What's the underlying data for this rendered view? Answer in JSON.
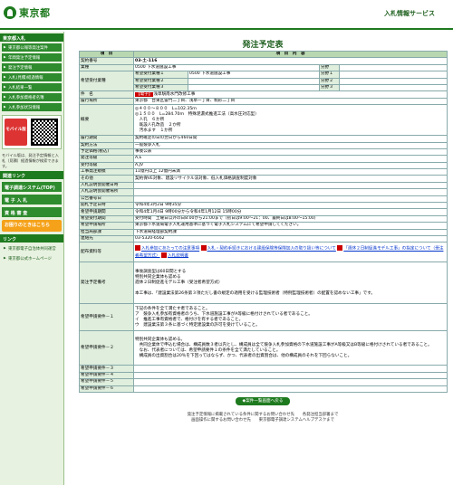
{
  "header": {
    "logo": "東京都",
    "top_link": "入札情報サービス"
  },
  "sidebar": {
    "head1": "東京都入札",
    "items1": [
      "東京都公報等発注案件",
      "年間発注予定情報",
      "発注予定情報",
      "入札(見積)経過情報",
      "入札結果一覧",
      "入札参加資格者名簿",
      "入札参加状況情報"
    ],
    "mobile_label": "モバイル版",
    "note": "モバイル版は、発注予定情報と入札（見積）経過情報が検索できます。",
    "head2": "関連リンク",
    "sys_btn": "電子調達システム(TOP)",
    "btn_bid": "電 子 入 札",
    "btn_qual": "資 格 審 査",
    "help": "お困りのときはこちら",
    "head3": "リンク",
    "items3": [
      "東京都電子自治体共同運営",
      "東京都公式ホームページ"
    ]
  },
  "main": {
    "title": "発注予定表",
    "col_item": "項　目",
    "col_content": "項　目　内　容",
    "contract_no_label": "契約番号",
    "contract_no": "03-土-116",
    "category_label": "業種",
    "category": "0500 下水道施設工事",
    "req_label": "希望受付業種",
    "req1_label": "希望受付業種１",
    "req1": "0500 下水道施設工事",
    "req2_label": "希望受付業種２",
    "req3_label": "希望受付業種３",
    "bun_label": "分野",
    "bun1": "分野１",
    "bun2": "分野２",
    "bun3": "分野３",
    "name_label": "件　名",
    "name_badge": "【電子】",
    "name": "浅草駅南水門改修工事",
    "place_label": "履行場所",
    "place": "東京都　台東区雷門二丁目、浅草一丁目、駒形二丁目",
    "summary_label": "概要",
    "summary_lines": [
      "◎４００～８００　L=102.35ｍ",
      "◎１５００　L=284.70ｍ　特殊泥濃式推進工法（高水圧対応型）",
      "　人孔　６か所",
      "　既設人孔改造　２か所",
      "　汚水ます　１か所"
    ],
    "period_label": "履行期間",
    "period": "契約確定の日の翌日から460日間",
    "method_label": "契約方法",
    "method": "一般競争入札",
    "budget_label": "予定価格(税込)",
    "budget": "事後公表",
    "rank_label": "発注等級",
    "rank": "A,E",
    "accept_label": "受付等級",
    "accept": "A,JV",
    "scale_label": "工事発注規模",
    "scale": "11億円以上 12億円未満",
    "other_label": "その他",
    "other": "契約保VE対象、建設リサイクル法対象、低入札価格調査制度対象",
    "r1": "入札説明会開催日時",
    "r2": "入札説明会開催場所",
    "r3": "公告番号日",
    "sched_label": "開札予定日時",
    "sched": "令和4年3月2日 9時35分",
    "app_label": "希望申請期間",
    "app": "令和4年1月4日 9時00分から令和4年1月12日 15時00分",
    "rec_label": "希望受付期間",
    "rec": "受付時間　土曜日以外の日8:00から21:00まで（初日は9:00～21：00、最終日は8:00～15:00）",
    "place2_label": "希望申請場所",
    "place2": "東京都下水道局電子入札運用基準に基づく電子入札システムにて希望申請してください。",
    "dept_label": "担当局部課",
    "dept": "下水道局経理部契約課",
    "tel_label": "連絡先",
    "tel": "03-5320-6562",
    "doc_label": "配布資料等",
    "doc_links": [
      "入札参加にあたっての注意事項",
      "入札・契約手続きにおける建設保険等保険加入の取り扱い等について",
      "「週休２日制促進モデル工事」の指定について（受注者希望方式）",
      "入札説明書"
    ],
    "cond_label": "発注予定備考",
    "cond_lines": [
      "事後調査型は60日間とする",
      "特別共同企業体も認める",
      "週休２日制促進モデル工事（受注者希望方式）",
      "",
      "本工事は、「建設業法第26条第３項ただし書の規定の適用を受ける監理技術者（特例監理技術者）の配置を認めない工事」です。"
    ],
    "req_e1_label": "希望申請要件－１",
    "req_e1_lines": [
      "下記の条件を全て満たす者であること。",
      "ア　競争入札参加有資格者のうち、下水道施設工事がA等級に格付けされている者であること。",
      "イ　推進工事有資格者で、格付けを有する者であること。",
      "ウ　建設業法第３条に基づく特定建設業の許可を受けていること。"
    ],
    "req_e2_label": "希望申請要件－２",
    "req_e2_lines": [
      "特別共同企業体も認める。",
      "　共同企業体で申込む場合は、構成員数３者以内とし、構成員は全て競争入札参加資格の下水道施設工事がA等級又はB等級に格付けされている者であること。",
      "　なお、代表者については、希望申請要件１の条件を全て満たしていること。",
      "　構成員の出資割合は20％を下回ってはならず、かつ、代表者の出資割合は、他の構成員のそれを下回らないこと。"
    ],
    "req_e3": "希望申請要件－３",
    "req_e4": "希望申請要件－４",
    "req_e5": "希望申請要件－５",
    "req_e6": "希望申請要件－６",
    "back_btn": "◆案件一覧画面へ戻る",
    "footer1": "発注予定情報に掲載されている条件に関するお問い合わせ先　　各発注担当部署まで",
    "footer2": "画面操作に関するお問い合わせ先　　東京都電子調達システムヘルプデスクまで"
  }
}
